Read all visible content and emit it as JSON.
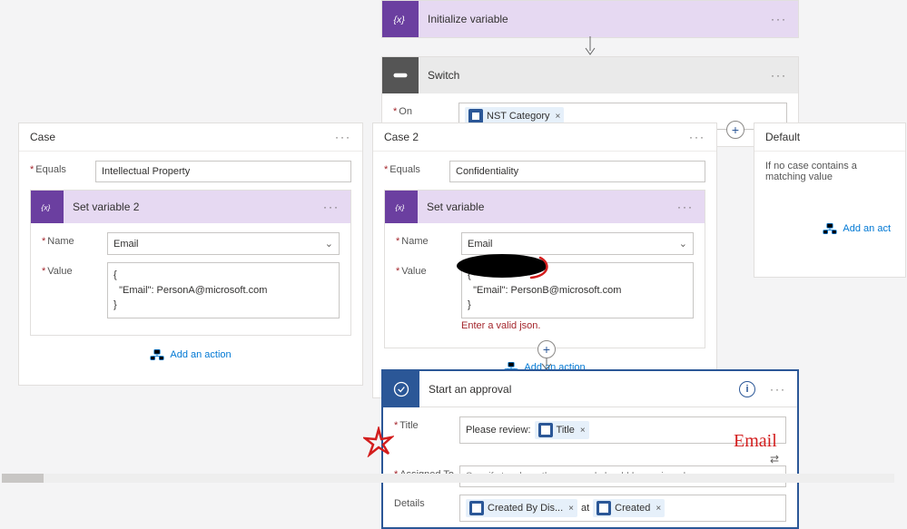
{
  "initVar": {
    "title": "Initialize variable"
  },
  "switch": {
    "title": "Switch",
    "onLabel": "On",
    "token": "NST Category"
  },
  "case1": {
    "title": "Case",
    "equalsLabel": "Equals",
    "equalsValue": "Intellectual Property",
    "action": {
      "title": "Set variable 2",
      "nameLabel": "Name",
      "nameValue": "Email",
      "valueLabel": "Value",
      "valueText": "{\n  \"Email\": PersonA@microsoft.com\n}"
    },
    "addAction": "Add an action"
  },
  "case2": {
    "title": "Case 2",
    "equalsLabel": "Equals",
    "equalsValue": "Confidentiality",
    "action": {
      "title": "Set variable",
      "nameLabel": "Name",
      "nameValue": "Email",
      "valueLabel": "Value",
      "valueText": "{\n  \"Email\": PersonB@microsoft.com\n}",
      "error": "Enter a valid json."
    },
    "addAction": "Add an action"
  },
  "default": {
    "title": "Default",
    "desc": "If no case contains a matching value",
    "addAction": "Add an act"
  },
  "approval": {
    "title": "Start an approval",
    "titleLabel": "Title",
    "titlePrefix": "Please review:",
    "titleToken": "Title",
    "assignedLabel": "Assigned To",
    "assignedPlaceholder": "Specify to whom the approval should be assigned.",
    "detailsLabel": "Details",
    "detailsToken1": "Created By Dis...",
    "detailsJoin": "at",
    "detailsToken2": "Created"
  },
  "annotations": {
    "email": "Email"
  }
}
